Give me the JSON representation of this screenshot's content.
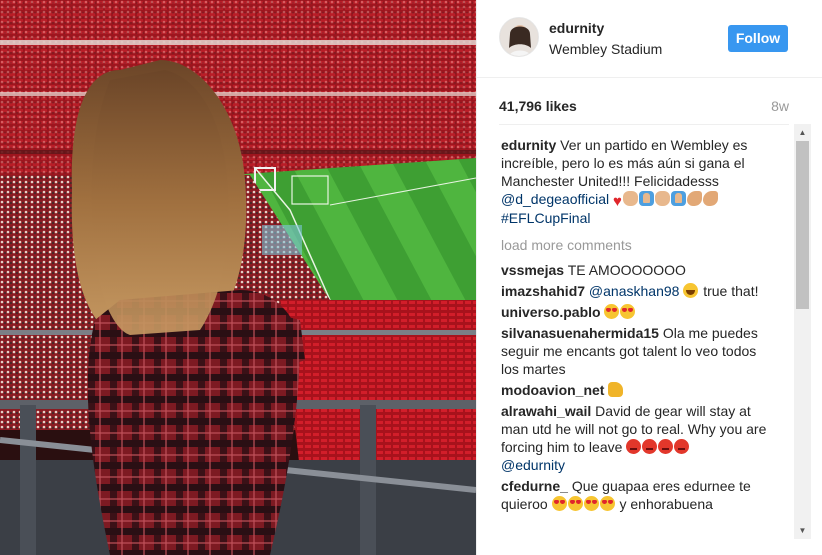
{
  "post": {
    "username": "edurnity",
    "location": "Wembley Stadium",
    "follow_label": "Follow",
    "likes": "41,796 likes",
    "age": "8w"
  },
  "caption": {
    "user": "edurnity",
    "text": "Ver un partido en Wembley es increíble, pero lo es más aún si gana el Manchester United!!! Felicidadesss",
    "mention": "@d_degeaofficial",
    "hashtag": "#EFLCupFinal"
  },
  "load_more": "load more comments",
  "comments": [
    {
      "user": "vssmejas",
      "text": "TE AMOOOOOOO"
    },
    {
      "user": "imazshahid7",
      "mention": "@anaskhan98",
      "text": "true that!"
    },
    {
      "user": "universo.pablo",
      "text": ""
    },
    {
      "user": "silvanasuenahermida15",
      "text": "Ola me puedes seguir me encants got talent lo veo todos los martes"
    },
    {
      "user": "modoavion_net",
      "text": ""
    },
    {
      "user": "alrawahi_wail",
      "text": "David de gear will stay at man utd he will not go to real. Why you are forcing him to leave",
      "mention": "@edurnity"
    },
    {
      "user": "cfedurne_",
      "text": "Que guapaa eres edurnee te quieroo",
      "text_after": "y enhorabuena"
    }
  ],
  "icons": {
    "avatar": "profile-photo",
    "scroll_up": "arrow-up-icon",
    "scroll_down": "arrow-down-icon"
  },
  "colors": {
    "follow_button": "#3897f0",
    "link": "#003569",
    "muted": "#999999"
  }
}
